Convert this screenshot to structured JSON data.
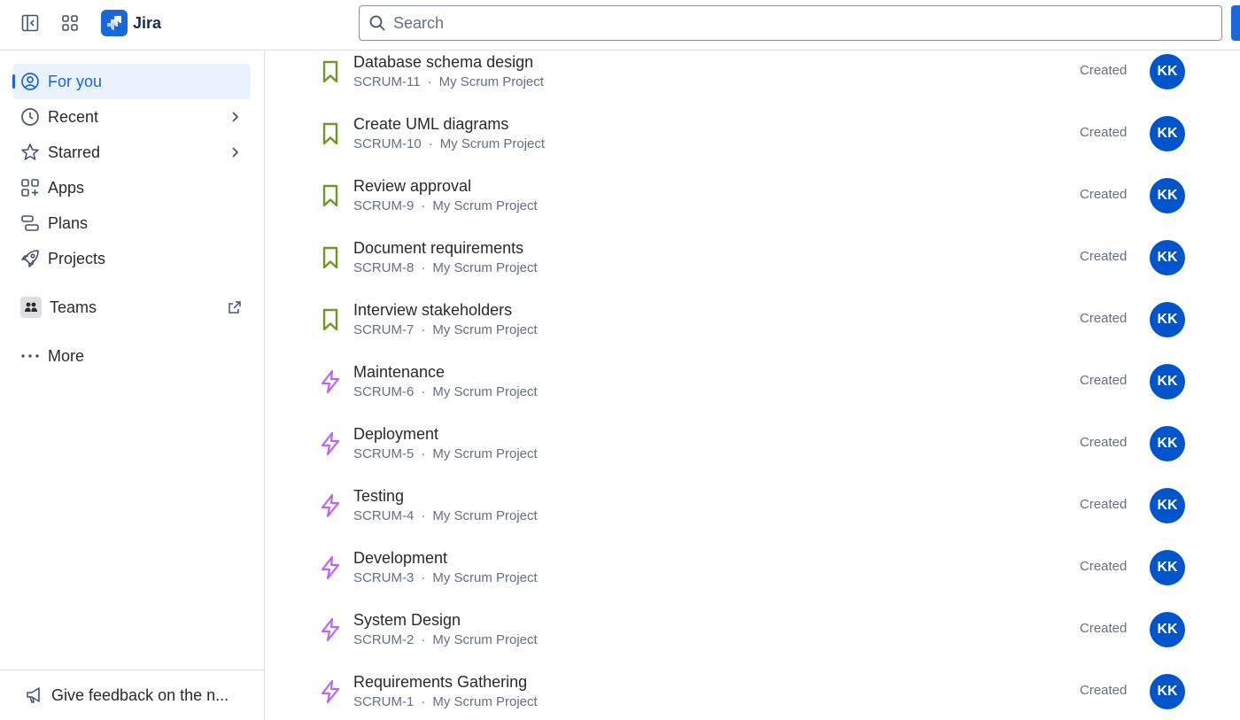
{
  "topbar": {
    "app_name": "Jira",
    "search_placeholder": "Search",
    "sidebar_toggle_icon": "sidebar-collapse-icon",
    "app_switcher_icon": "grid-icon"
  },
  "sidebar": {
    "items": [
      {
        "label": "For you",
        "icon": "user-circle-icon",
        "active": true
      },
      {
        "label": "Recent",
        "icon": "clock-icon",
        "chevron": true
      },
      {
        "label": "Starred",
        "icon": "star-icon",
        "chevron": true
      },
      {
        "label": "Apps",
        "icon": "apps-icon"
      },
      {
        "label": "Plans",
        "icon": "plans-icon"
      },
      {
        "label": "Projects",
        "icon": "rocket-icon"
      },
      {
        "label": "Teams",
        "icon": "teams-icon",
        "external": true
      },
      {
        "label": "More",
        "icon": "more-icon"
      }
    ],
    "feedback_label": "Give feedback on the n..."
  },
  "colors": {
    "accent": "#1868db",
    "story": "#6a9a23",
    "epic": "#bf63f3",
    "avatar": "#0055cc"
  },
  "items": [
    {
      "title": "Database schema design",
      "key": "SCRUM-11",
      "project": "My Scrum Project",
      "type": "story",
      "status": "Created",
      "avatar": "KK"
    },
    {
      "title": "Create UML diagrams",
      "key": "SCRUM-10",
      "project": "My Scrum Project",
      "type": "story",
      "status": "Created",
      "avatar": "KK"
    },
    {
      "title": "Review approval",
      "key": "SCRUM-9",
      "project": "My Scrum Project",
      "type": "story",
      "status": "Created",
      "avatar": "KK"
    },
    {
      "title": "Document requirements",
      "key": "SCRUM-8",
      "project": "My Scrum Project",
      "type": "story",
      "status": "Created",
      "avatar": "KK"
    },
    {
      "title": "Interview stakeholders",
      "key": "SCRUM-7",
      "project": "My Scrum Project",
      "type": "story",
      "status": "Created",
      "avatar": "KK"
    },
    {
      "title": "Maintenance",
      "key": "SCRUM-6",
      "project": "My Scrum Project",
      "type": "epic",
      "status": "Created",
      "avatar": "KK"
    },
    {
      "title": "Deployment",
      "key": "SCRUM-5",
      "project": "My Scrum Project",
      "type": "epic",
      "status": "Created",
      "avatar": "KK"
    },
    {
      "title": "Testing",
      "key": "SCRUM-4",
      "project": "My Scrum Project",
      "type": "epic",
      "status": "Created",
      "avatar": "KK"
    },
    {
      "title": "Development",
      "key": "SCRUM-3",
      "project": "My Scrum Project",
      "type": "epic",
      "status": "Created",
      "avatar": "KK"
    },
    {
      "title": "System Design",
      "key": "SCRUM-2",
      "project": "My Scrum Project",
      "type": "epic",
      "status": "Created",
      "avatar": "KK"
    },
    {
      "title": "Requirements Gathering",
      "key": "SCRUM-1",
      "project": "My Scrum Project",
      "type": "epic",
      "status": "Created",
      "avatar": "KK"
    }
  ]
}
